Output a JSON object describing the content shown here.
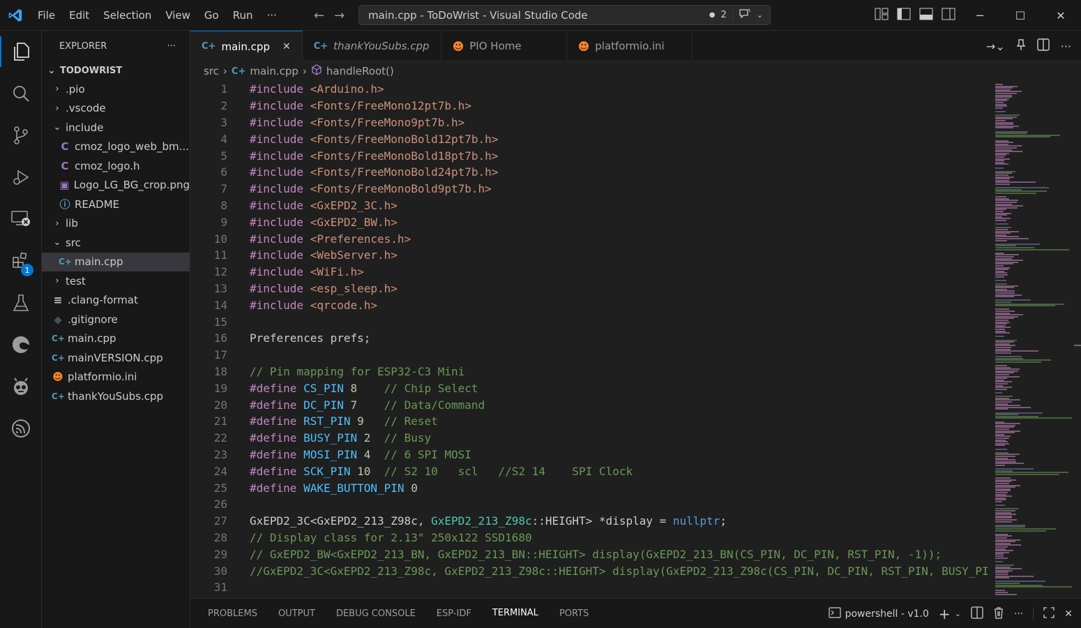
{
  "window": {
    "title": "main.cpp - ToDoWrist - Visual Studio Code",
    "menu": [
      "File",
      "Edit",
      "Selection",
      "View",
      "Go",
      "Run",
      "···"
    ],
    "notification_count": "2"
  },
  "activity_bar": {
    "extensions_badge": "1"
  },
  "sidebar": {
    "header": "EXPLORER",
    "more": "···",
    "section": "TODOWRIST",
    "items": [
      {
        "label": ".pio",
        "kind": "folder",
        "indent": 0,
        "expanded": false
      },
      {
        "label": ".vscode",
        "kind": "folder",
        "indent": 0,
        "expanded": false
      },
      {
        "label": "include",
        "kind": "folder",
        "indent": 0,
        "expanded": true
      },
      {
        "label": "cmoz_logo_web_bm...",
        "kind": "c",
        "indent": 1
      },
      {
        "label": "cmoz_logo.h",
        "kind": "c",
        "indent": 1
      },
      {
        "label": "Logo_LG_BG_crop.png",
        "kind": "image",
        "indent": 1
      },
      {
        "label": "README",
        "kind": "info",
        "indent": 1
      },
      {
        "label": "lib",
        "kind": "folder",
        "indent": 0,
        "expanded": false
      },
      {
        "label": "src",
        "kind": "folder",
        "indent": 0,
        "expanded": true
      },
      {
        "label": "main.cpp",
        "kind": "cpp",
        "indent": 1,
        "selected": true
      },
      {
        "label": "test",
        "kind": "folder",
        "indent": 0,
        "expanded": false
      },
      {
        "label": ".clang-format",
        "kind": "lines",
        "indent": 0
      },
      {
        "label": ".gitignore",
        "kind": "git",
        "indent": 0
      },
      {
        "label": "main.cpp",
        "kind": "cpp",
        "indent": 0
      },
      {
        "label": "mainVERSION.cpp",
        "kind": "cpp",
        "indent": 0
      },
      {
        "label": "platformio.ini",
        "kind": "pio",
        "indent": 0
      },
      {
        "label": "thankYouSubs.cpp",
        "kind": "cpp",
        "indent": 0
      }
    ]
  },
  "tabs": [
    {
      "label": "main.cpp",
      "icon": "cpp",
      "active": true,
      "italic": false
    },
    {
      "label": "thankYouSubs.cpp",
      "icon": "cpp",
      "active": false,
      "italic": true
    },
    {
      "label": "PIO Home",
      "icon": "pio",
      "active": false,
      "italic": false
    },
    {
      "label": "platformio.ini",
      "icon": "pio",
      "active": false,
      "italic": false
    }
  ],
  "breadcrumb": {
    "folder": "src",
    "file": "main.cpp",
    "symbol": "handleRoot()"
  },
  "code_lines": [
    [
      [
        "pp",
        "#include "
      ],
      [
        "inc",
        "<Arduino.h>"
      ]
    ],
    [
      [
        "pp",
        "#include "
      ],
      [
        "inc",
        "<Fonts/FreeMono12pt7b.h>"
      ]
    ],
    [
      [
        "pp",
        "#include "
      ],
      [
        "inc",
        "<Fonts/FreeMono9pt7b.h>"
      ]
    ],
    [
      [
        "pp",
        "#include "
      ],
      [
        "inc",
        "<Fonts/FreeMonoBold12pt7b.h>"
      ]
    ],
    [
      [
        "pp",
        "#include "
      ],
      [
        "inc",
        "<Fonts/FreeMonoBold18pt7b.h>"
      ]
    ],
    [
      [
        "pp",
        "#include "
      ],
      [
        "inc",
        "<Fonts/FreeMonoBold24pt7b.h>"
      ]
    ],
    [
      [
        "pp",
        "#include "
      ],
      [
        "inc",
        "<Fonts/FreeMonoBold9pt7b.h>"
      ]
    ],
    [
      [
        "pp",
        "#include "
      ],
      [
        "inc",
        "<GxEPD2_3C.h>"
      ]
    ],
    [
      [
        "pp",
        "#include "
      ],
      [
        "inc",
        "<GxEPD2_BW.h>"
      ]
    ],
    [
      [
        "pp",
        "#include "
      ],
      [
        "inc",
        "<Preferences.h>"
      ]
    ],
    [
      [
        "pp",
        "#include "
      ],
      [
        "inc",
        "<WebServer.h>"
      ]
    ],
    [
      [
        "pp",
        "#include "
      ],
      [
        "inc",
        "<WiFi.h>"
      ]
    ],
    [
      [
        "pp",
        "#include "
      ],
      [
        "inc",
        "<esp_sleep.h>"
      ]
    ],
    [
      [
        "pp",
        "#include "
      ],
      [
        "inc",
        "<qrcode.h>"
      ]
    ],
    [],
    [
      [
        "txt",
        "Preferences prefs;"
      ]
    ],
    [],
    [
      [
        "cmt",
        "// Pin mapping for ESP32-C3 Mini"
      ]
    ],
    [
      [
        "pp",
        "#define "
      ],
      [
        "def",
        "CS_PIN"
      ],
      [
        "txt",
        " "
      ],
      [
        "num",
        "8"
      ],
      [
        "txt",
        "    "
      ],
      [
        "cmt",
        "// Chip Select"
      ]
    ],
    [
      [
        "pp",
        "#define "
      ],
      [
        "def",
        "DC_PIN"
      ],
      [
        "txt",
        " "
      ],
      [
        "num",
        "7"
      ],
      [
        "txt",
        "    "
      ],
      [
        "cmt",
        "// Data/Command"
      ]
    ],
    [
      [
        "pp",
        "#define "
      ],
      [
        "def",
        "RST_PIN"
      ],
      [
        "txt",
        " "
      ],
      [
        "num",
        "9"
      ],
      [
        "txt",
        "   "
      ],
      [
        "cmt",
        "// Reset"
      ]
    ],
    [
      [
        "pp",
        "#define "
      ],
      [
        "def",
        "BUSY_PIN"
      ],
      [
        "txt",
        " "
      ],
      [
        "num",
        "2"
      ],
      [
        "txt",
        "  "
      ],
      [
        "cmt",
        "// Busy"
      ]
    ],
    [
      [
        "pp",
        "#define "
      ],
      [
        "def",
        "MOSI_PIN"
      ],
      [
        "txt",
        " "
      ],
      [
        "num",
        "4"
      ],
      [
        "txt",
        "  "
      ],
      [
        "cmt",
        "// 6 SPI MOSI"
      ]
    ],
    [
      [
        "pp",
        "#define "
      ],
      [
        "def",
        "SCK_PIN"
      ],
      [
        "txt",
        " "
      ],
      [
        "num",
        "10"
      ],
      [
        "txt",
        "  "
      ],
      [
        "cmt",
        "// S2 10   scl   //S2 14    SPI Clock"
      ]
    ],
    [
      [
        "pp",
        "#define "
      ],
      [
        "def",
        "WAKE_BUTTON_PIN"
      ],
      [
        "txt",
        " "
      ],
      [
        "num",
        "0"
      ]
    ],
    [],
    [
      [
        "txt",
        "GxEPD2_3C<GxEPD2_213_Z98c, "
      ],
      [
        "typ",
        "GxEPD2_213_Z98c"
      ],
      [
        "txt",
        "::HEIGHT> *display = "
      ],
      [
        "kw",
        "nullptr"
      ],
      [
        "txt",
        ";"
      ]
    ],
    [
      [
        "cmt",
        "// Display class for 2.13\" 250x122 SSD1680"
      ]
    ],
    [
      [
        "cmt",
        "// GxEPD2_BW<GxEPD2_213_BN, GxEPD2_213_BN::HEIGHT> display(GxEPD2_213_BN(CS_PIN, DC_PIN, RST_PIN, -1));"
      ]
    ],
    [
      [
        "cmt",
        "//GxEPD2_3C<GxEPD2_213_Z98c, GxEPD2_213_Z98c::HEIGHT> display(GxEPD2_213_Z98c(CS_PIN, DC_PIN, RST_PIN, BUSY_PI"
      ]
    ],
    []
  ],
  "panel": {
    "tabs": [
      "PROBLEMS",
      "OUTPUT",
      "DEBUG CONSOLE",
      "ESP-IDF",
      "TERMINAL",
      "PORTS"
    ],
    "active_tab": "TERMINAL",
    "terminal_name": "powershell - v1.0",
    "more": "···"
  },
  "colors": {
    "accent": "#0078d4",
    "preprocessor": "#c586c0",
    "string": "#ce9178",
    "macro": "#4fc1ff",
    "number": "#b5cea8",
    "comment": "#6a9955",
    "type": "#4ec9b0",
    "keyword": "#569cd6"
  }
}
